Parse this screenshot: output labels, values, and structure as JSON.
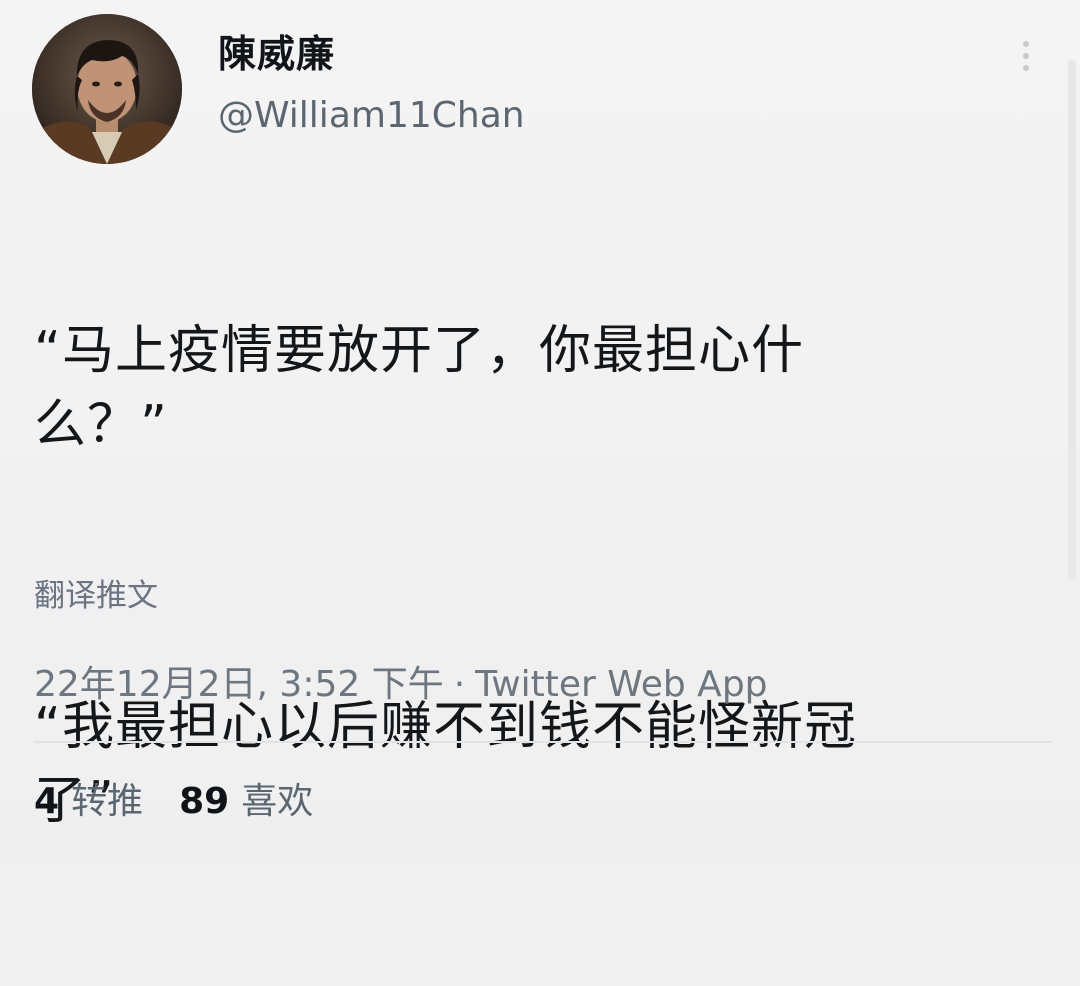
{
  "user": {
    "display_name": "陳威廉",
    "handle": "@William11Chan"
  },
  "tweet": {
    "paragraphs": [
      "“马上疫情要放开了，你最担心什\n么？”",
      "“我最担心以后赚不到钱不能怪新冠\n了”"
    ],
    "translate_label": "翻译推文",
    "timestamp": "22年12月2日, 3:52 下午",
    "separator": "·",
    "source": "Twitter Web App"
  },
  "stats": {
    "retweets_count": "4",
    "retweets_label": "转推",
    "likes_count": "89",
    "likes_label": "喜欢"
  },
  "icons": {
    "more": "more-vertical-icon"
  }
}
